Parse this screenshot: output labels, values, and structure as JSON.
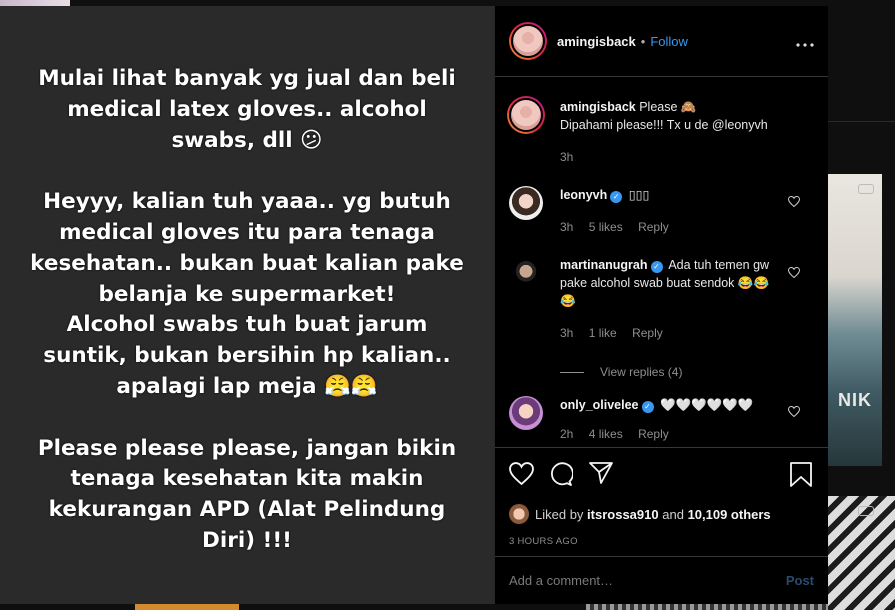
{
  "post": {
    "image_text": "Mulai lihat banyak yg jual dan beli\nmedical latex gloves.. alcohol\nswabs, dll 😕\n\nHeyyy, kalian tuh yaaa.. yg butuh\nmedical gloves itu para tenaga\nkesehatan.. bukan buat kalian pake\nbelanja ke supermarket!\nAlcohol swabs tuh buat jarum\nsuntik, bukan bersihin hp kalian..\napalagi lap meja 😤😤\n\nPlease please please, jangan bikin\ntenaga kesehatan kita makin\nkekurangan APD (Alat Pelindung\nDiri) !!!"
  },
  "header": {
    "username": "amingisback",
    "dot": "•",
    "follow_label": "Follow",
    "more_icon": "more-horizontal-icon"
  },
  "caption": {
    "username": "amingisback",
    "text_line1": "Please 🙈",
    "text_line2": "Dipahami please!!! Tx u de @leonyvh",
    "time": "3h"
  },
  "comments": [
    {
      "username": "leonyvh",
      "verified": true,
      "text": "▯▯▯",
      "time": "3h",
      "likes": "5 likes",
      "reply": "Reply"
    },
    {
      "username": "martinanugrah",
      "verified": true,
      "text": "Ada tuh temen gw pake alcohol swab buat sendok 😂😂😂",
      "time": "3h",
      "likes": "1 like",
      "reply": "Reply"
    },
    {
      "username": "only_olivelee",
      "verified": true,
      "text": "🤍🤍🤍🤍🤍🤍",
      "time": "2h",
      "likes": "4 likes",
      "reply": "Reply"
    }
  ],
  "view_replies": "View replies (4)",
  "likes": {
    "prefix": "Liked by",
    "user": "itsrossa910",
    "and": "and",
    "others": "10,109 others"
  },
  "time_ago": "3 HOURS AGO",
  "add_comment": {
    "placeholder": "Add a comment…",
    "post_label": "Post"
  },
  "backdrop": {
    "thumb_label": "NIK"
  },
  "colors": {
    "accent": "#3897f0",
    "panel": "#000000",
    "media_bg": "#2a2a2a"
  }
}
